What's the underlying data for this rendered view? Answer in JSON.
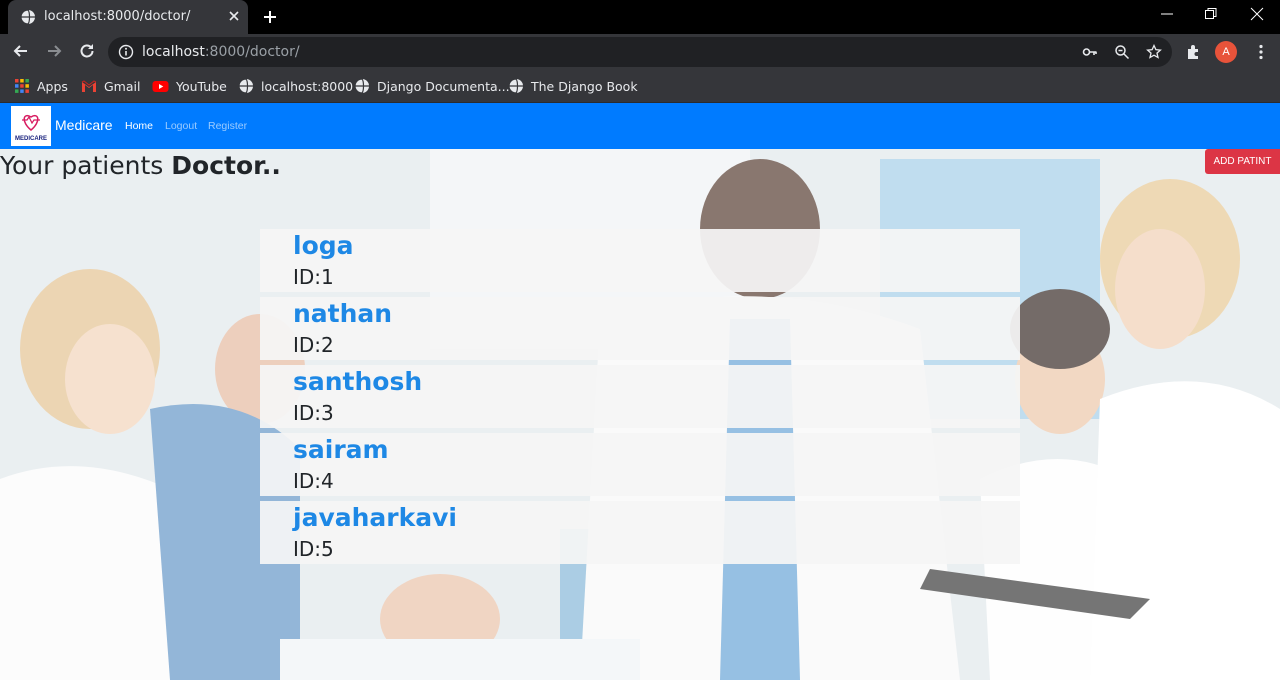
{
  "browser": {
    "tab_title": "localhost:8000/doctor/",
    "url_host": "localhost",
    "url_rest": ":8000/doctor/",
    "avatar_letter": "A",
    "bookmarks": [
      "Apps",
      "Gmail",
      "YouTube",
      "localhost:8000",
      "Django Documenta...",
      "The Django Book"
    ]
  },
  "navbar": {
    "brand": "Medicare",
    "logo_text": "MEDICARE",
    "links": [
      "Home",
      "Logout",
      "Register"
    ],
    "active_link": "Home",
    "color": "#007bff"
  },
  "page": {
    "heading_prefix": "Your patients ",
    "heading_strong": "Doctor..",
    "add_button": "ADD PATINT"
  },
  "patients": [
    {
      "name": "loga",
      "id": "ID:1"
    },
    {
      "name": "nathan",
      "id": "ID:2"
    },
    {
      "name": "santhosh",
      "id": "ID:3"
    },
    {
      "name": "sairam",
      "id": "ID:4"
    },
    {
      "name": "javaharkavi",
      "id": "ID:5"
    }
  ]
}
